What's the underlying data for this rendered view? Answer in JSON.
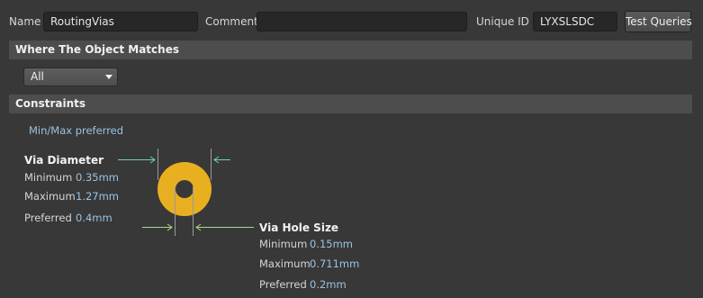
{
  "header": {
    "name_label": "Name",
    "name_value": "RoutingVias",
    "comment_label": "Comment",
    "comment_value": "",
    "uid_label": "Unique ID",
    "uid_value": "LYXSLSDC",
    "test_button": "Test Queries"
  },
  "match": {
    "title": "Where The Object Matches",
    "selected": "All"
  },
  "constraints": {
    "title": "Constraints",
    "mode_link": "Min/Max preferred",
    "via_diameter": {
      "title": "Via Diameter",
      "min_label": "Minimum",
      "min_value": "0.35mm",
      "max_label": "Maximum",
      "max_value": "1.27mm",
      "pref_label": "Preferred",
      "pref_value": "0.4mm"
    },
    "via_hole": {
      "title": "Via Hole Size",
      "min_label": "Minimum",
      "min_value": "0.15mm",
      "max_label": "Maximum",
      "max_value": "0.711mm",
      "pref_label": "Preferred",
      "pref_value": "0.2mm"
    }
  },
  "colors": {
    "background": "#383838",
    "section": "#4d4d4d",
    "via_ring": "#e8b020",
    "value_text": "#9bc3e0",
    "dimension_line": "#6fcfc0",
    "hole_dimension_line": "#a8d890"
  },
  "icons": {
    "dropdown": "chevron-down-icon"
  }
}
